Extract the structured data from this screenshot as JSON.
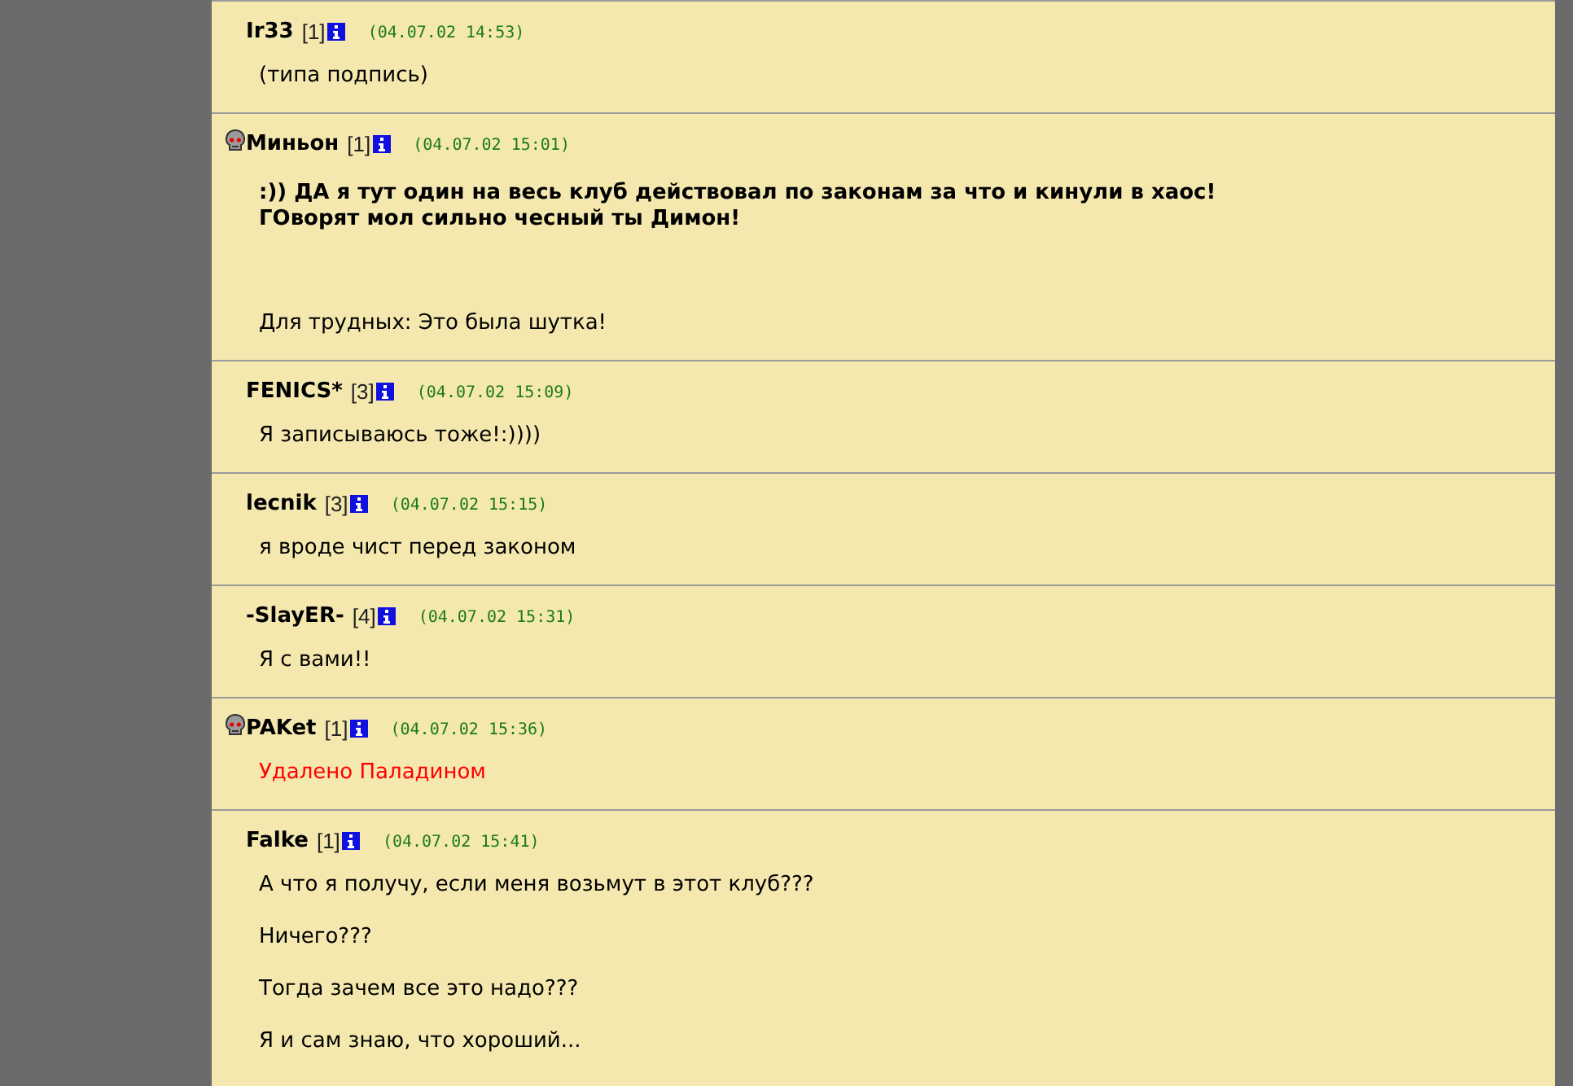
{
  "posts": [
    {
      "emblem": false,
      "author": "Ir33",
      "level": "[1]",
      "date": "(04.07.02 14:53)",
      "paragraphs": [
        {
          "kind": "normal",
          "lines": [
            "(типа подпись)"
          ]
        }
      ]
    },
    {
      "emblem": true,
      "author": "Миньон",
      "level": "[1]",
      "date": "(04.07.02 15:01)",
      "paragraphs": [
        {
          "kind": "bold",
          "lines": [
            ":)) ДА я тут один на весь клуб действовал по законам за что и кинули в хаос!",
            "ГОворят мол сильно чесный ты Димон!"
          ]
        },
        {
          "kind": "normal",
          "lines": [
            "Для трудных: Это была шутка!"
          ]
        }
      ]
    },
    {
      "emblem": false,
      "author": "FENICS*",
      "level": "[3]",
      "date": "(04.07.02 15:09)",
      "paragraphs": [
        {
          "kind": "normal",
          "lines": [
            "Я записываюсь тоже!:))))"
          ]
        }
      ]
    },
    {
      "emblem": false,
      "author": "lecnik",
      "level": "[3]",
      "date": "(04.07.02 15:15)",
      "paragraphs": [
        {
          "kind": "normal",
          "lines": [
            "я вроде чист перед законом"
          ]
        }
      ]
    },
    {
      "emblem": false,
      "author": "-SlayER-",
      "level": "[4]",
      "date": "(04.07.02 15:31)",
      "paragraphs": [
        {
          "kind": "normal",
          "lines": [
            "Я с вами!!"
          ]
        }
      ]
    },
    {
      "emblem": true,
      "author": "PAKet",
      "level": "[1]",
      "date": "(04.07.02 15:36)",
      "paragraphs": [
        {
          "kind": "deleted",
          "lines": [
            "Удалено Паладином"
          ]
        }
      ]
    },
    {
      "emblem": false,
      "author": "Falke",
      "level": "[1]",
      "date": "(04.07.02 15:41)",
      "paragraphs": [
        {
          "kind": "normal",
          "lines": [
            "А что я получу, если меня возьмут в этот клуб???"
          ]
        },
        {
          "kind": "normal",
          "lines": [
            "Ничего???"
          ]
        },
        {
          "kind": "normal",
          "lines": [
            "Тогда зачем все это надо???"
          ]
        },
        {
          "kind": "normal",
          "lines": [
            "Я и сам знаю, что хороший..."
          ]
        }
      ]
    }
  ]
}
